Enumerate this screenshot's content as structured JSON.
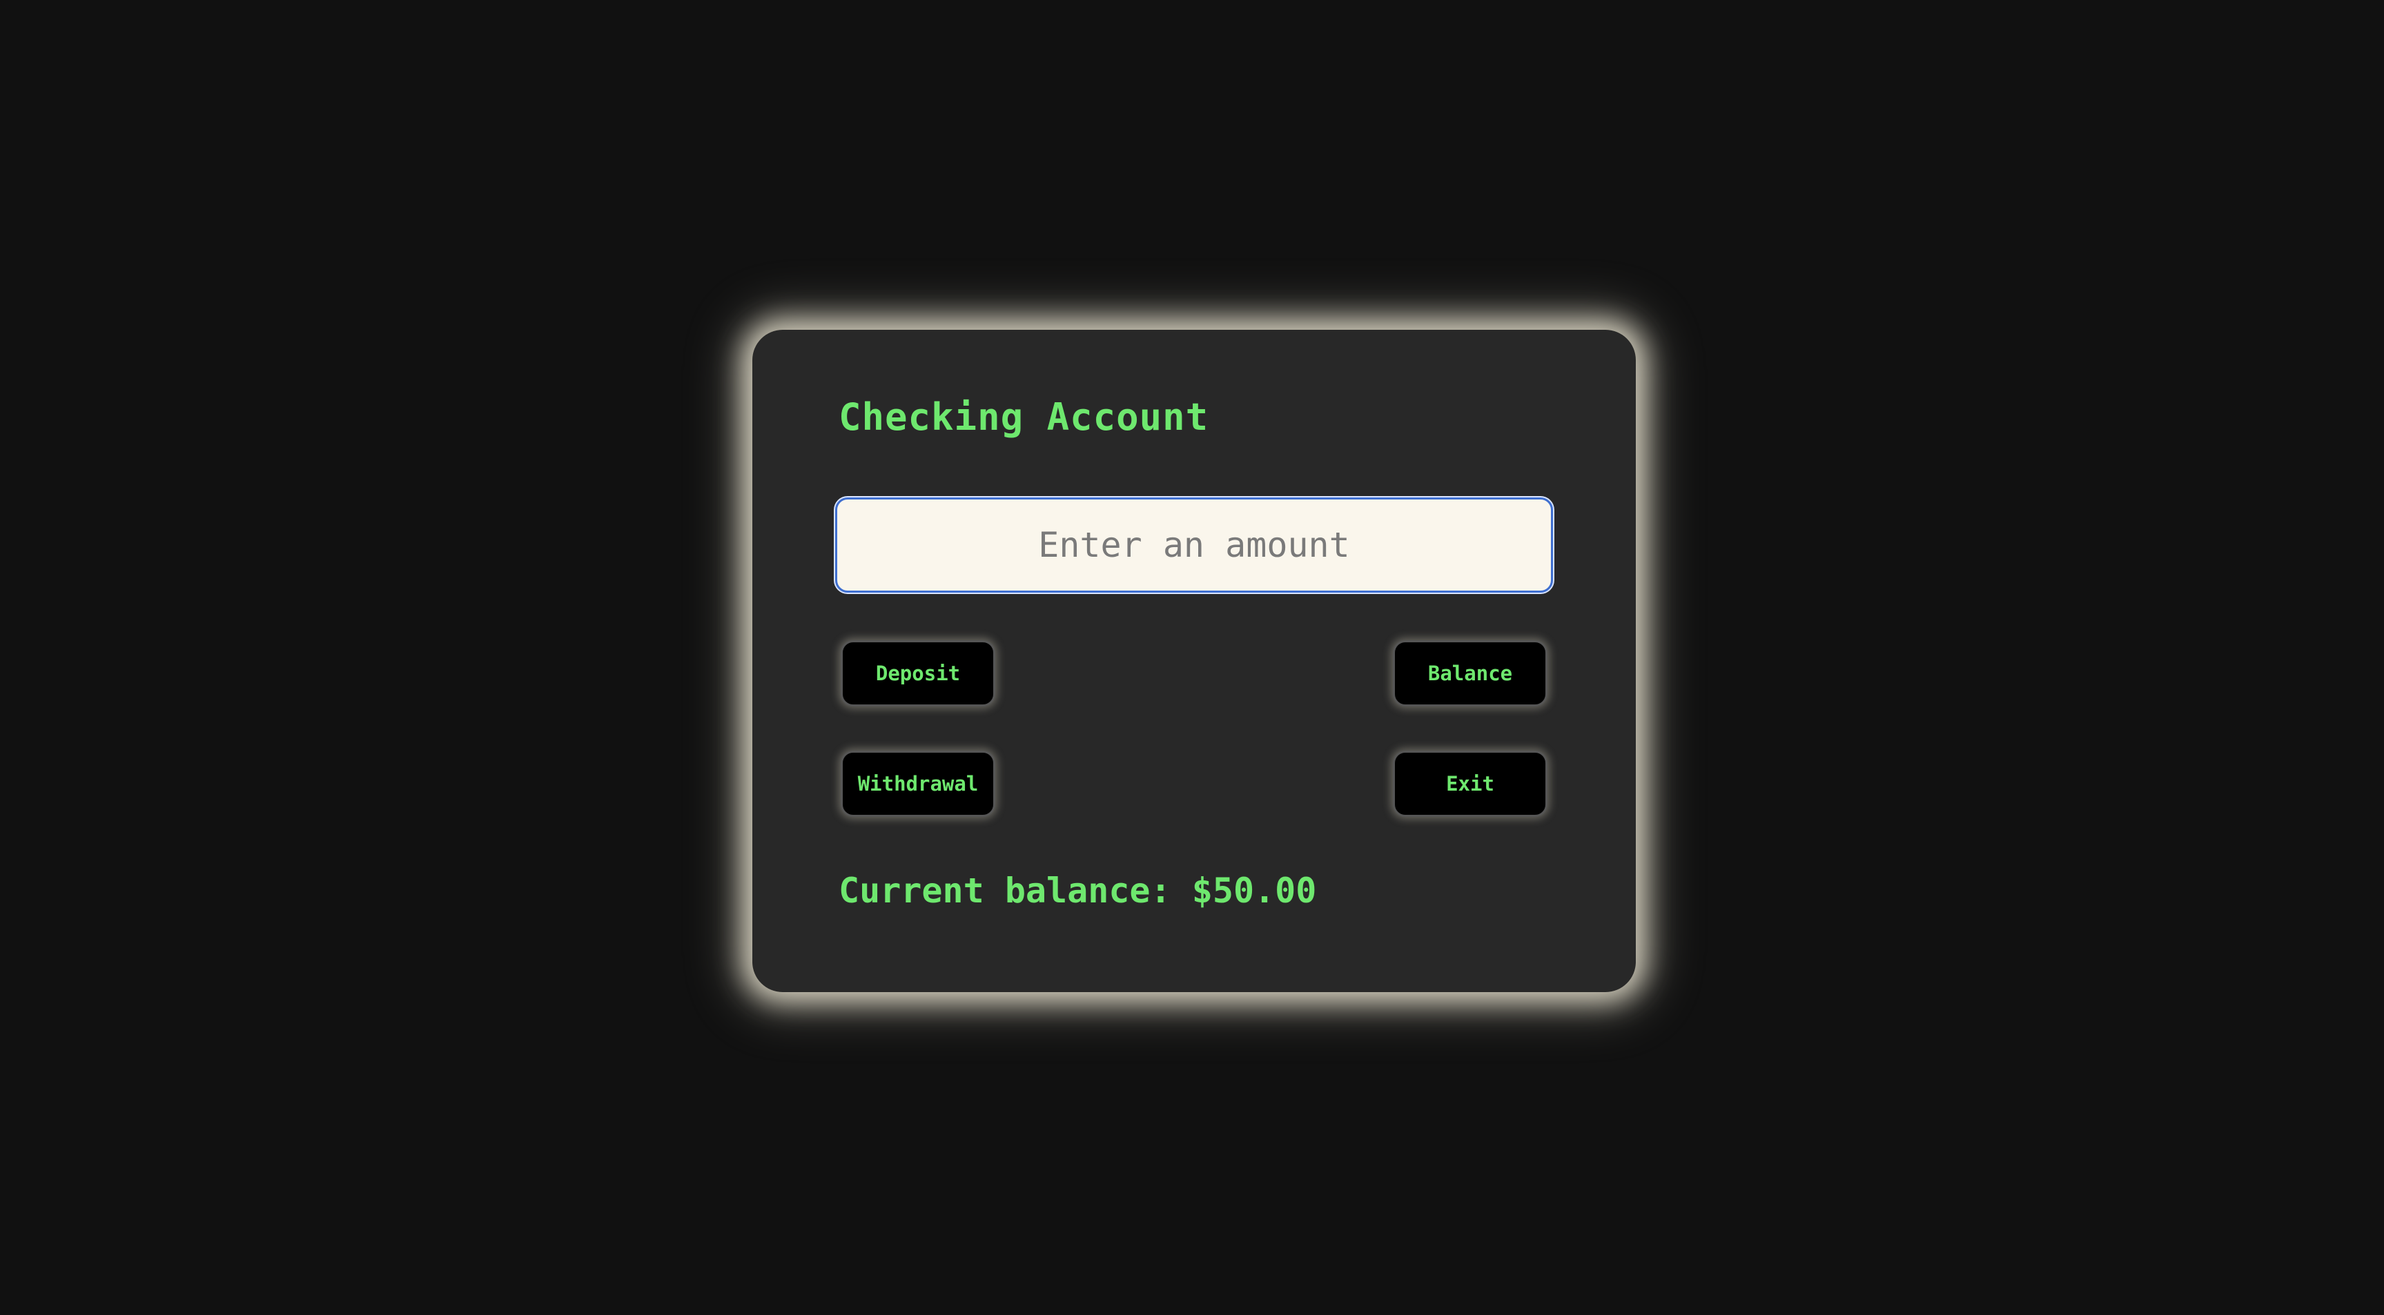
{
  "account": {
    "title": "Checking Account",
    "amount_placeholder": "Enter an amount",
    "amount_value": ""
  },
  "actions": {
    "deposit_label": "Deposit",
    "balance_label": "Balance",
    "withdrawal_label": "Withdrawal",
    "exit_label": "Exit"
  },
  "status": {
    "balance_text": "Current balance: $50.00"
  },
  "colors": {
    "background": "#111111",
    "card": "#282828",
    "accent_text": "#6ee86e",
    "input_background": "#faf6ec",
    "input_focus_border": "#3f6fd0",
    "button_background": "#000000",
    "card_glow": "#f0ead6"
  }
}
